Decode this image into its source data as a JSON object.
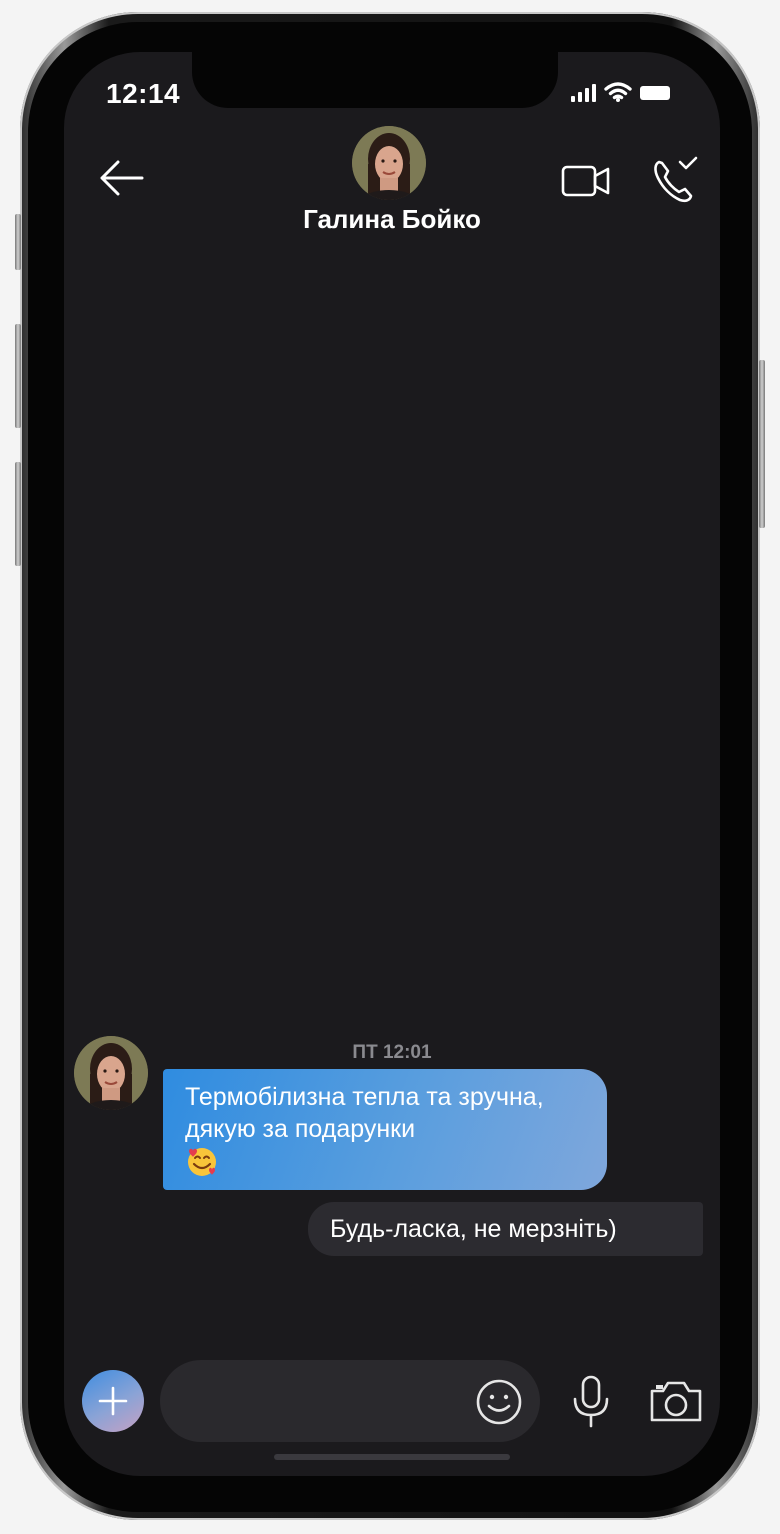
{
  "status_bar": {
    "time": "12:14"
  },
  "header": {
    "contact_name": "Галина Бойко"
  },
  "conversation": {
    "timestamp": "ПТ 12:01",
    "messages": [
      {
        "direction": "incoming",
        "text": "Термобілизна тепла та зручна, дякую за подарунки",
        "emoji": "smiling-face-with-hearts"
      },
      {
        "direction": "outgoing",
        "text": "Будь-ласка, не мерзніть)"
      }
    ]
  },
  "composer": {
    "message_value": "",
    "message_placeholder": ""
  },
  "icons": {
    "back": "arrow-left-icon",
    "video": "video-camera-icon",
    "call": "phone-call-icon",
    "add": "plus-icon",
    "emoji": "smiley-icon",
    "mic": "microphone-icon",
    "camera": "camera-icon"
  },
  "colors": {
    "screen_background": "#1b1a1d",
    "incoming_bubble_start": "#2f8ce0",
    "incoming_bubble_end": "#7fa7dc",
    "outgoing_bubble": "#2c2b30",
    "composer_background": "#2a292d"
  }
}
